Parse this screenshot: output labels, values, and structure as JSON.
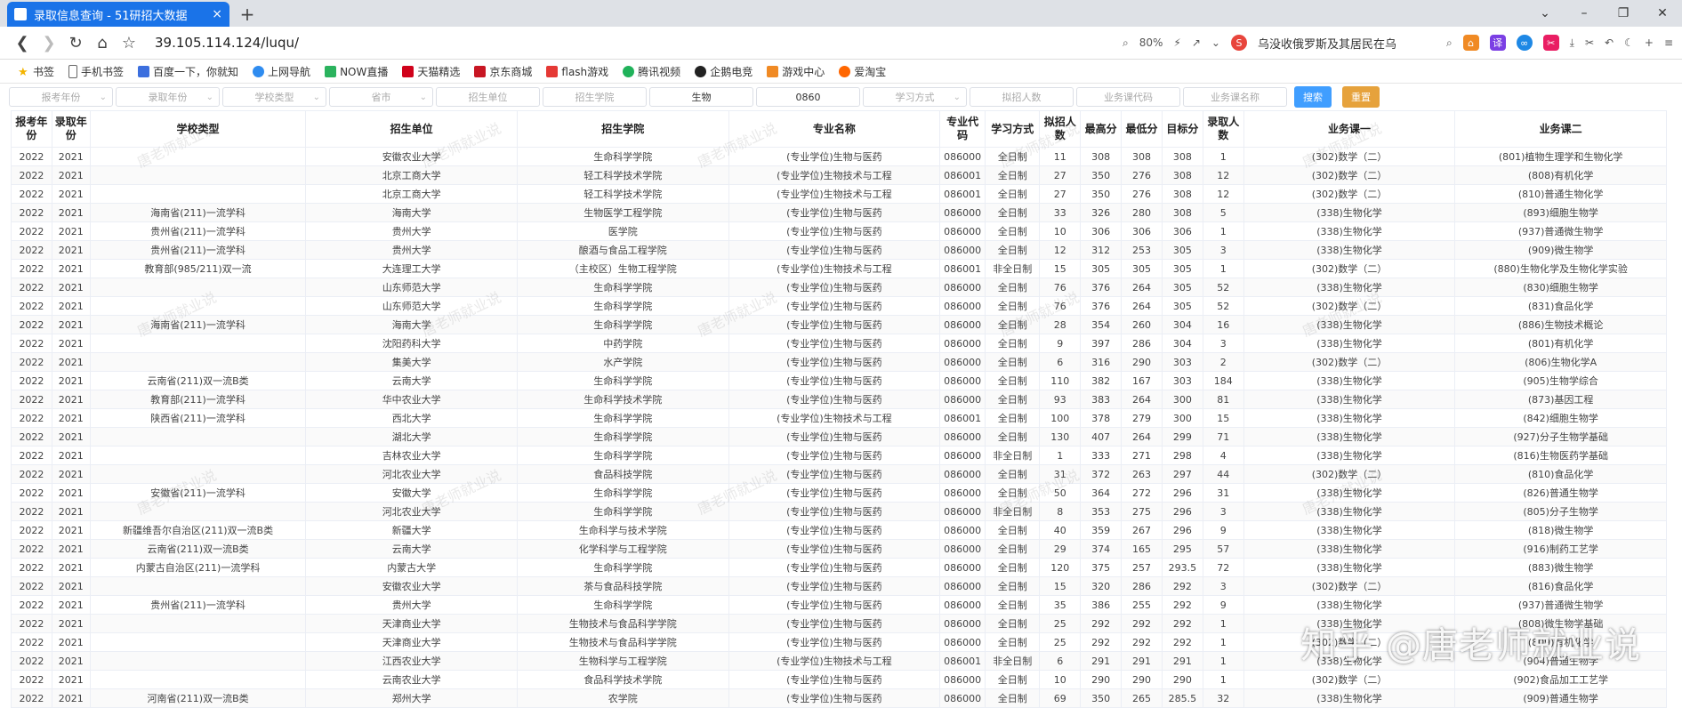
{
  "tab": {
    "title": "录取信息查询 - 51研招大数据",
    "close": "×",
    "new_tab": "+"
  },
  "window_controls": [
    "⌄",
    "–",
    "❐",
    "✕"
  ],
  "address": {
    "url": "39.105.114.124/luqu/",
    "zoom": "80%",
    "search_text": "乌没收俄罗斯及其居民在乌"
  },
  "bookmarks": [
    "书签",
    "手机书签",
    "百度一下，你就知",
    "上网导航",
    "NOW直播",
    "天猫精选",
    "京东商城",
    "flash游戏",
    "腾讯视频",
    "企鹅电竞",
    "游戏中心",
    "爱淘宝"
  ],
  "filters": {
    "fields": [
      "报考年份",
      "录取年份",
      "学校类型",
      "省市",
      "招生单位",
      "招生学院",
      "生物",
      "0860",
      "学习方式",
      "拟招人数",
      "业务课代码",
      "业务课名称"
    ],
    "search_label": "搜索",
    "reset_label": "重置",
    "accent_color": "#409eff",
    "reset_color": "#e6a23c"
  },
  "table": {
    "headers": [
      "报考年份",
      "录取年份",
      "学校类型",
      "招生单位",
      "招生学院",
      "专业名称",
      "专业代码",
      "学习方式",
      "拟招人数",
      "最高分",
      "最低分",
      "目标分",
      "录取人数",
      "业务课一",
      "业务课二"
    ],
    "rows": [
      [
        "2022",
        "2021",
        "",
        "安徽农业大学",
        "生命科学学院",
        "(专业学位)生物与医药",
        "086000",
        "全日制",
        "11",
        "308",
        "308",
        "308",
        "1",
        "(302)数学（二）",
        "(801)植物生理学和生物化学"
      ],
      [
        "2022",
        "2021",
        "",
        "北京工商大学",
        "轻工科学技术学院",
        "(专业学位)生物技术与工程",
        "086001",
        "全日制",
        "27",
        "350",
        "276",
        "308",
        "12",
        "(302)数学（二）",
        "(808)有机化学"
      ],
      [
        "2022",
        "2021",
        "",
        "北京工商大学",
        "轻工科学技术学院",
        "(专业学位)生物技术与工程",
        "086001",
        "全日制",
        "27",
        "350",
        "276",
        "308",
        "12",
        "(302)数学（二）",
        "(810)普通生物化学"
      ],
      [
        "2022",
        "2021",
        "海南省(211)一流学科",
        "海南大学",
        "生物医学工程学院",
        "(专业学位)生物与医药",
        "086000",
        "全日制",
        "33",
        "326",
        "280",
        "308",
        "5",
        "(338)生物化学",
        "(893)细胞生物学"
      ],
      [
        "2022",
        "2021",
        "贵州省(211)一流学科",
        "贵州大学",
        "医学院",
        "(专业学位)生物与医药",
        "086000",
        "全日制",
        "10",
        "306",
        "306",
        "306",
        "1",
        "(338)生物化学",
        "(937)普通微生物学"
      ],
      [
        "2022",
        "2021",
        "贵州省(211)一流学科",
        "贵州大学",
        "酿酒与食品工程学院",
        "(专业学位)生物与医药",
        "086000",
        "全日制",
        "12",
        "312",
        "253",
        "305",
        "3",
        "(338)生物化学",
        "(909)微生物学"
      ],
      [
        "2022",
        "2021",
        "教育部(985/211)双一流",
        "大连理工大学",
        "（主校区）生物工程学院",
        "(专业学位)生物技术与工程",
        "086001",
        "非全日制",
        "15",
        "305",
        "305",
        "305",
        "1",
        "(302)数学（二）",
        "(880)生物化学及生物化学实验"
      ],
      [
        "2022",
        "2021",
        "",
        "山东师范大学",
        "生命科学学院",
        "(专业学位)生物与医药",
        "086000",
        "全日制",
        "76",
        "376",
        "264",
        "305",
        "52",
        "(338)生物化学",
        "(830)细胞生物学"
      ],
      [
        "2022",
        "2021",
        "",
        "山东师范大学",
        "生命科学学院",
        "(专业学位)生物与医药",
        "086000",
        "全日制",
        "76",
        "376",
        "264",
        "305",
        "52",
        "(302)数学（二）",
        "(831)食品化学"
      ],
      [
        "2022",
        "2021",
        "海南省(211)一流学科",
        "海南大学",
        "生命科学学院",
        "(专业学位)生物与医药",
        "086000",
        "全日制",
        "28",
        "354",
        "260",
        "304",
        "16",
        "(338)生物化学",
        "(886)生物技术概论"
      ],
      [
        "2022",
        "2021",
        "",
        "沈阳药科大学",
        "中药学院",
        "(专业学位)生物与医药",
        "086000",
        "全日制",
        "9",
        "397",
        "286",
        "304",
        "3",
        "(338)生物化学",
        "(801)有机化学"
      ],
      [
        "2022",
        "2021",
        "",
        "集美大学",
        "水产学院",
        "(专业学位)生物与医药",
        "086000",
        "全日制",
        "6",
        "316",
        "290",
        "303",
        "2",
        "(302)数学（二）",
        "(806)生物化学A"
      ],
      [
        "2022",
        "2021",
        "云南省(211)双一流B类",
        "云南大学",
        "生命科学学院",
        "(专业学位)生物与医药",
        "086000",
        "全日制",
        "110",
        "382",
        "167",
        "303",
        "184",
        "(338)生物化学",
        "(905)生物学综合"
      ],
      [
        "2022",
        "2021",
        "教育部(211)一流学科",
        "华中农业大学",
        "生命科学技术学院",
        "(专业学位)生物与医药",
        "086000",
        "全日制",
        "93",
        "383",
        "264",
        "300",
        "81",
        "(338)生物化学",
        "(873)基因工程"
      ],
      [
        "2022",
        "2021",
        "陕西省(211)一流学科",
        "西北大学",
        "生命科学学院",
        "(专业学位)生物技术与工程",
        "086001",
        "全日制",
        "100",
        "378",
        "279",
        "300",
        "15",
        "(338)生物化学",
        "(842)细胞生物学"
      ],
      [
        "2022",
        "2021",
        "",
        "湖北大学",
        "生命科学学院",
        "(专业学位)生物与医药",
        "086000",
        "全日制",
        "130",
        "407",
        "264",
        "299",
        "71",
        "(338)生物化学",
        "(927)分子生物学基础"
      ],
      [
        "2022",
        "2021",
        "",
        "吉林农业大学",
        "生命科学学院",
        "(专业学位)生物与医药",
        "086000",
        "非全日制",
        "1",
        "333",
        "271",
        "298",
        "4",
        "(338)生物化学",
        "(816)生物医药学基础"
      ],
      [
        "2022",
        "2021",
        "",
        "河北农业大学",
        "食品科技学院",
        "(专业学位)生物与医药",
        "086000",
        "全日制",
        "31",
        "372",
        "263",
        "297",
        "44",
        "(302)数学（二）",
        "(810)食品化学"
      ],
      [
        "2022",
        "2021",
        "安徽省(211)一流学科",
        "安徽大学",
        "生命科学学院",
        "(专业学位)生物与医药",
        "086000",
        "全日制",
        "50",
        "364",
        "272",
        "296",
        "31",
        "(338)生物化学",
        "(826)普通生物学"
      ],
      [
        "2022",
        "2021",
        "",
        "河北农业大学",
        "生命科学学院",
        "(专业学位)生物与医药",
        "086000",
        "非全日制",
        "8",
        "353",
        "275",
        "296",
        "3",
        "(338)生物化学",
        "(805)分子生物学"
      ],
      [
        "2022",
        "2021",
        "新疆维吾尔自治区(211)双一流B类",
        "新疆大学",
        "生命科学与技术学院",
        "(专业学位)生物与医药",
        "086000",
        "全日制",
        "40",
        "359",
        "267",
        "296",
        "9",
        "(338)生物化学",
        "(818)微生物学"
      ],
      [
        "2022",
        "2021",
        "云南省(211)双一流B类",
        "云南大学",
        "化学科学与工程学院",
        "(专业学位)生物与医药",
        "086000",
        "全日制",
        "29",
        "374",
        "165",
        "295",
        "57",
        "(338)生物化学",
        "(916)制药工艺学"
      ],
      [
        "2022",
        "2021",
        "内蒙古自治区(211)一流学科",
        "内蒙古大学",
        "生命科学学院",
        "(专业学位)生物与医药",
        "086000",
        "全日制",
        "120",
        "375",
        "257",
        "293.5",
        "72",
        "(338)生物化学",
        "(883)微生物学"
      ],
      [
        "2022",
        "2021",
        "",
        "安徽农业大学",
        "茶与食品科技学院",
        "(专业学位)生物与医药",
        "086000",
        "全日制",
        "15",
        "320",
        "286",
        "292",
        "3",
        "(302)数学（二）",
        "(816)食品化学"
      ],
      [
        "2022",
        "2021",
        "贵州省(211)一流学科",
        "贵州大学",
        "生命科学学院",
        "(专业学位)生物与医药",
        "086000",
        "全日制",
        "35",
        "386",
        "255",
        "292",
        "9",
        "(338)生物化学",
        "(937)普通微生物学"
      ],
      [
        "2022",
        "2021",
        "",
        "天津商业大学",
        "生物技术与食品科学学院",
        "(专业学位)生物与医药",
        "086000",
        "全日制",
        "25",
        "292",
        "292",
        "292",
        "1",
        "(338)生物化学",
        "(808)微生物学基础"
      ],
      [
        "2022",
        "2021",
        "",
        "天津商业大学",
        "生物技术与食品科学学院",
        "(专业学位)生物与医药",
        "086000",
        "全日制",
        "25",
        "292",
        "292",
        "292",
        "1",
        "(302)数学（二）",
        "(809)有机化学"
      ],
      [
        "2022",
        "2021",
        "",
        "江西农业大学",
        "生物科学与工程学院",
        "(专业学位)生物技术与工程",
        "086001",
        "非全日制",
        "6",
        "291",
        "291",
        "291",
        "1",
        "(338)生物化学",
        "(904)普通生物学"
      ],
      [
        "2022",
        "2021",
        "",
        "云南农业大学",
        "食品科学技术学院",
        "(专业学位)生物与医药",
        "086000",
        "全日制",
        "10",
        "290",
        "290",
        "290",
        "1",
        "(302)数学（二）",
        "(902)食品加工工艺学"
      ],
      [
        "2022",
        "2021",
        "河南省(211)双一流B类",
        "郑州大学",
        "农学院",
        "(专业学位)生物与医药",
        "086000",
        "全日制",
        "69",
        "350",
        "265",
        "285.5",
        "32",
        "(338)生物化学",
        "(909)普通生物学"
      ]
    ]
  },
  "watermark": "唐老师就业说",
  "overlay": "知乎 @唐老师就业说"
}
